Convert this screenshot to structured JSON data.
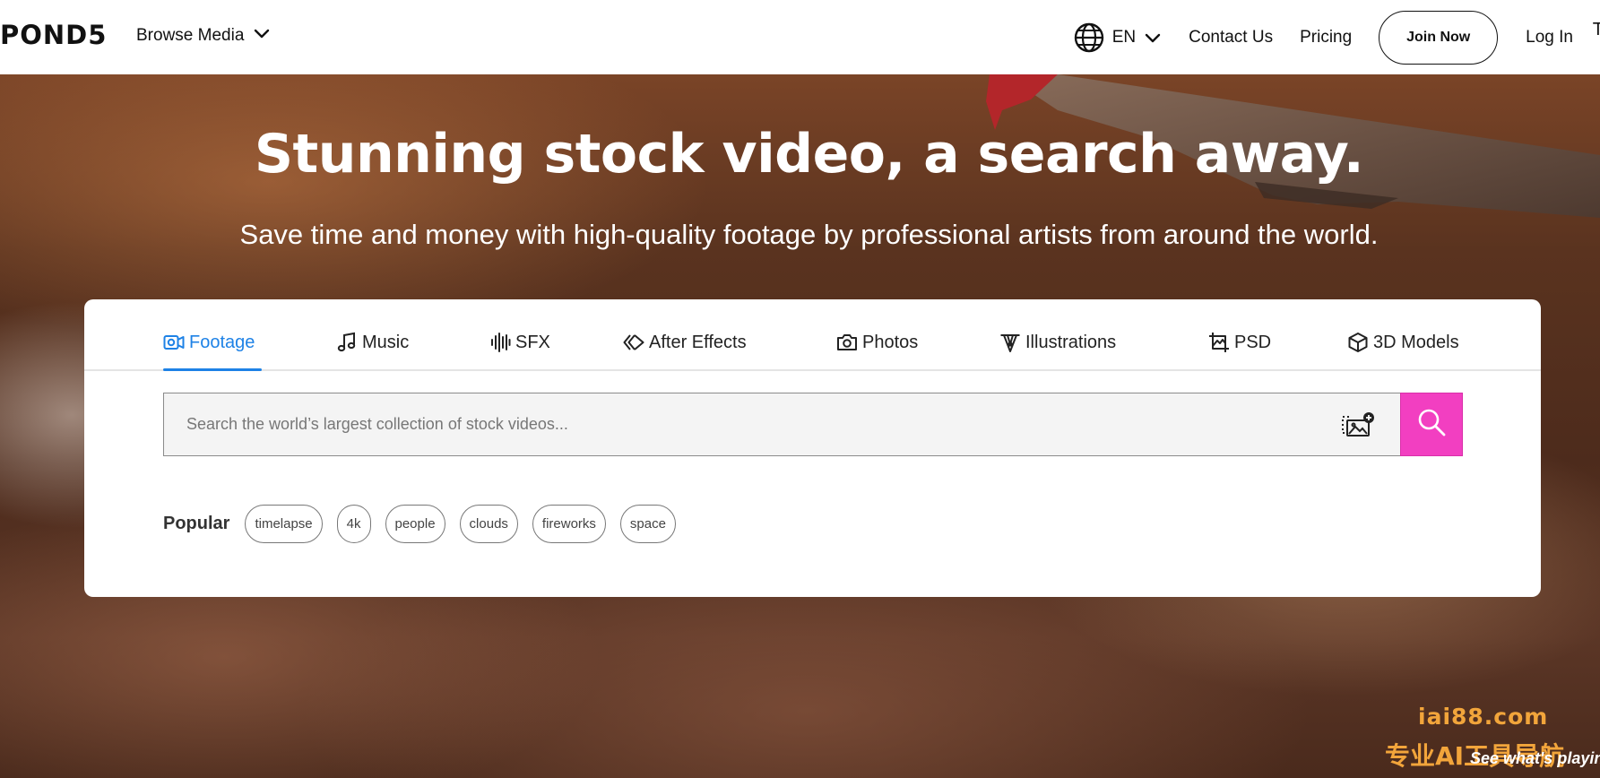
{
  "header": {
    "logo": "POND5",
    "browse_label": "Browse Media",
    "language": "EN",
    "contact_label": "Contact Us",
    "pricing_label": "Pricing",
    "join_label": "Join Now",
    "login_label": "Log In",
    "edge_glyph": "T"
  },
  "hero": {
    "title": "Stunning stock video, a search away.",
    "subtitle": "Save time and money with high-quality footage by professional artists from around the world."
  },
  "tabs": [
    {
      "label": "Footage",
      "icon": "video-camera-icon",
      "active": true
    },
    {
      "label": "Music",
      "icon": "music-note-icon",
      "active": false
    },
    {
      "label": "SFX",
      "icon": "waveform-icon",
      "active": false
    },
    {
      "label": "After Effects",
      "icon": "after-effects-icon",
      "active": false
    },
    {
      "label": "Photos",
      "icon": "camera-icon",
      "active": false
    },
    {
      "label": "Illustrations",
      "icon": "pen-nib-icon",
      "active": false
    },
    {
      "label": "PSD",
      "icon": "psd-crop-icon",
      "active": false
    },
    {
      "label": "3D Models",
      "icon": "cube-icon",
      "active": false
    }
  ],
  "search": {
    "placeholder": "Search the world’s largest collection of stock videos...",
    "value": ""
  },
  "popular": {
    "label": "Popular",
    "tags": [
      "timelapse",
      "4k",
      "people",
      "clouds",
      "fireworks",
      "space"
    ]
  },
  "watermark": {
    "url": "iai88.com",
    "text": "专业AI工具导航",
    "overlay": "See what's playing"
  },
  "colors": {
    "accent_blue": "#1e82e6",
    "search_button": "#f23fc1",
    "text_dark": "#111111",
    "watermark_orange": "#f2a53b"
  }
}
